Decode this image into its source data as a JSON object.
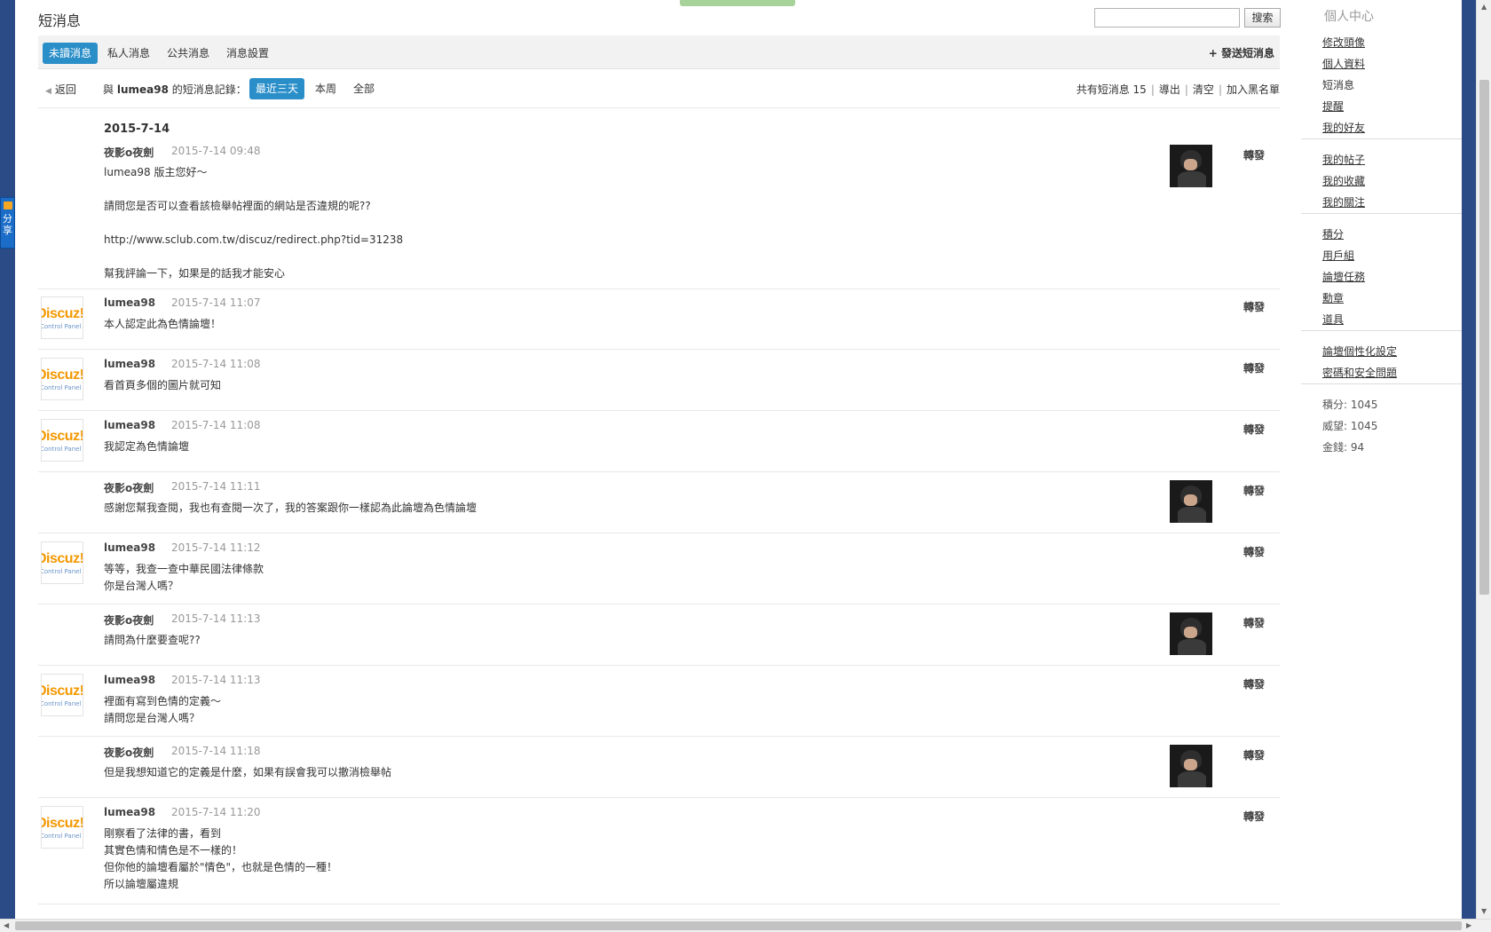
{
  "page": {
    "title": "短消息",
    "search_button": "搜索",
    "search_value": ""
  },
  "tabs": [
    {
      "label": "未讀消息",
      "active": true
    },
    {
      "label": "私人消息",
      "active": false
    },
    {
      "label": "公共消息",
      "active": false
    },
    {
      "label": "消息設置",
      "active": false
    }
  ],
  "send_link": "+ 發送短消息",
  "subbar": {
    "back": "返回",
    "record_prefix": "與 ",
    "record_user": "lumea98",
    "record_suffix": " 的短消息記錄：",
    "ranges": [
      {
        "label": "最近三天",
        "active": true
      },
      {
        "label": "本周",
        "active": false
      },
      {
        "label": "全部",
        "active": false
      }
    ],
    "count_label": "共有短消息 15",
    "export": "導出",
    "clear": "清空",
    "blacklist": "加入黑名單"
  },
  "date_header": "2015-7-14",
  "forward_label": "轉發",
  "messages": [
    {
      "author": "夜影o夜劍",
      "time": "2015-7-14 09:48",
      "side": "right",
      "lines": [
        "lumea98 版主您好～",
        "",
        "請問您是否可以查看該檢舉帖裡面的網站是否違規的呢??",
        "",
        "http://www.sclub.com.tw/discuz/redirect.php?tid=31238",
        "",
        "幫我評論一下，如果是的話我才能安心"
      ]
    },
    {
      "author": "lumea98",
      "time": "2015-7-14 11:07",
      "side": "left",
      "lines": [
        "本人認定此為色情論壇！"
      ]
    },
    {
      "author": "lumea98",
      "time": "2015-7-14 11:08",
      "side": "left",
      "lines": [
        "看首頁多個的圖片就可知"
      ]
    },
    {
      "author": "lumea98",
      "time": "2015-7-14 11:08",
      "side": "left",
      "lines": [
        "我認定為色情論壇"
      ]
    },
    {
      "author": "夜影o夜劍",
      "time": "2015-7-14 11:11",
      "side": "right",
      "lines": [
        "感謝您幫我查閱，我也有查閱一次了，我的答案跟你一樣認為此論壇為色情論壇"
      ]
    },
    {
      "author": "lumea98",
      "time": "2015-7-14 11:12",
      "side": "left",
      "lines": [
        "等等，我查一查中華民國法律條款",
        "你是台灣人嗎？"
      ]
    },
    {
      "author": "夜影o夜劍",
      "time": "2015-7-14 11:13",
      "side": "right",
      "lines": [
        "請問為什麼要查呢??"
      ]
    },
    {
      "author": "lumea98",
      "time": "2015-7-14 11:13",
      "side": "left",
      "lines": [
        "裡面有寫到色情的定義～",
        "請問您是台灣人嗎？"
      ]
    },
    {
      "author": "夜影o夜劍",
      "time": "2015-7-14 11:18",
      "side": "right",
      "lines": [
        "但是我想知道它的定義是什麼，如果有誤會我可以撤消檢舉帖"
      ]
    },
    {
      "author": "lumea98",
      "time": "2015-7-14 11:20",
      "side": "left",
      "lines": [
        "剛察看了法律的書，看到",
        "其實色情和情色是不一樣的！",
        "但你他的論壇看屬於\"情色\"，也就是色情的一種！",
        "所以論壇屬違規"
      ]
    }
  ],
  "logo": {
    "text": "Discuz!",
    "sub": "Control Panel"
  },
  "share_tab": "分享",
  "sidebar": {
    "title": "個人中心",
    "groups": [
      [
        {
          "label": "修改頭像",
          "link": true
        },
        {
          "label": "個人資料",
          "link": true
        },
        {
          "label": "短消息",
          "link": false
        },
        {
          "label": "提醒",
          "link": true
        },
        {
          "label": "我的好友",
          "link": true
        }
      ],
      [
        {
          "label": "我的帖子",
          "link": true
        },
        {
          "label": "我的收藏",
          "link": true
        },
        {
          "label": "我的關注",
          "link": true
        }
      ],
      [
        {
          "label": "積分",
          "link": true
        },
        {
          "label": "用戶組",
          "link": true
        },
        {
          "label": "論壇任務",
          "link": true
        },
        {
          "label": "勳章",
          "link": true
        },
        {
          "label": "道具",
          "link": true
        }
      ],
      [
        {
          "label": "論壇個性化設定",
          "link": true
        },
        {
          "label": "密碼和安全問題",
          "link": true
        }
      ]
    ],
    "stats": [
      "積分: 1045",
      "威望: 1045",
      "金錢: 94"
    ]
  },
  "colors": {
    "accent": "#2a8ec8",
    "frame": "#2b4b86"
  }
}
